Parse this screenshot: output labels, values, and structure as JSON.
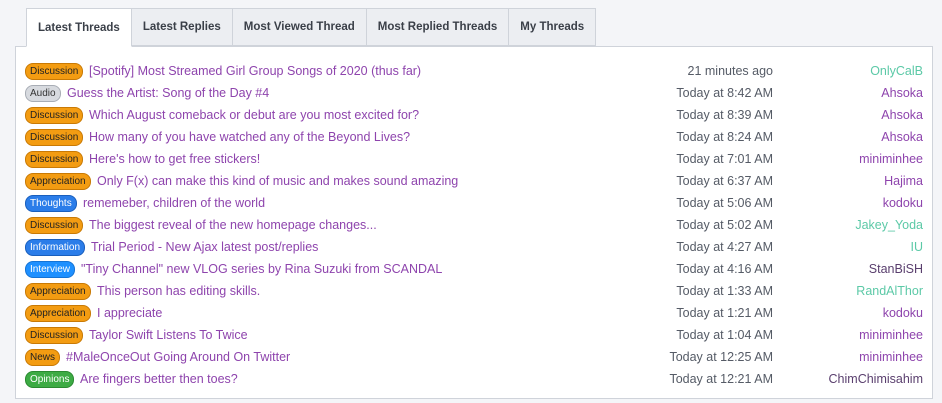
{
  "tabs": [
    {
      "label": "Latest Threads",
      "active": true
    },
    {
      "label": "Latest Replies",
      "active": false
    },
    {
      "label": "Most Viewed Thread",
      "active": false
    },
    {
      "label": "Most Replied Threads",
      "active": false
    },
    {
      "label": "My Threads",
      "active": false
    }
  ],
  "prefix_styles": {
    "Discussion": {
      "bg": "#f39c12",
      "border": "#c97a05",
      "color": "#222222"
    },
    "Audio": {
      "bg": "#d7dadf",
      "border": "#a8adb5",
      "color": "#333333"
    },
    "Appreciation": {
      "bg": "#f39c12",
      "border": "#c97a05",
      "color": "#222222"
    },
    "Thoughts": {
      "bg": "#2b7de9",
      "border": "#1a5fbd",
      "color": "#ffffff"
    },
    "Information": {
      "bg": "#2b7de9",
      "border": "#1a5fbd",
      "color": "#ffffff"
    },
    "Interview": {
      "bg": "#1e90ff",
      "border": "#1573d4",
      "color": "#ffffff"
    },
    "News": {
      "bg": "#f39c12",
      "border": "#c97a05",
      "color": "#222222"
    },
    "Opinions": {
      "bg": "#3dab44",
      "border": "#2b8a31",
      "color": "#ffffff"
    }
  },
  "user_colors": {
    "default": "#8e44ad",
    "teal": "#5cc9a7",
    "dark": "#5a3f6e"
  },
  "threads": [
    {
      "prefix": "Discussion",
      "title": "[Spotify] Most Streamed Girl Group Songs of 2020 (thus far)",
      "time": "21 minutes ago",
      "user": "OnlyCalB",
      "user_color": "teal"
    },
    {
      "prefix": "Audio",
      "title": "Guess the Artist: Song of the Day #4",
      "time": "Today at 8:42 AM",
      "user": "Ahsoka",
      "user_color": "default"
    },
    {
      "prefix": "Discussion",
      "title": "Which August comeback or debut are you most excited for?",
      "time": "Today at 8:39 AM",
      "user": "Ahsoka",
      "user_color": "default"
    },
    {
      "prefix": "Discussion",
      "title": "How many of you have watched any of the Beyond Lives?",
      "time": "Today at 8:24 AM",
      "user": "Ahsoka",
      "user_color": "default"
    },
    {
      "prefix": "Discussion",
      "title": "Here's how to get free stickers!",
      "time": "Today at 7:01 AM",
      "user": "miniminhee",
      "user_color": "default"
    },
    {
      "prefix": "Appreciation",
      "title": "Only F(x) can make this kind of music and makes sound amazing",
      "time": "Today at 6:37 AM",
      "user": "Hajima",
      "user_color": "default"
    },
    {
      "prefix": "Thoughts",
      "title": "rememeber, children of the world",
      "time": "Today at 5:06 AM",
      "user": "kodoku",
      "user_color": "default"
    },
    {
      "prefix": "Discussion",
      "title": "The biggest reveal of the new homepage changes...",
      "time": "Today at 5:02 AM",
      "user": "Jakey_Yoda",
      "user_color": "teal"
    },
    {
      "prefix": "Information",
      "title": "Trial Period - New Ajax latest post/replies",
      "time": "Today at 4:27 AM",
      "user": "IU",
      "user_color": "teal"
    },
    {
      "prefix": "Interview",
      "title": "\"Tiny Channel\" new VLOG series by Rina Suzuki from SCANDAL",
      "time": "Today at 4:16 AM",
      "user": "StanBiSH",
      "user_color": "dark"
    },
    {
      "prefix": "Appreciation",
      "title": "This person has editing skills.",
      "time": "Today at 1:33 AM",
      "user": "RandAlThor",
      "user_color": "teal"
    },
    {
      "prefix": "Appreciation",
      "title": "I appreciate",
      "time": "Today at 1:21 AM",
      "user": "kodoku",
      "user_color": "default"
    },
    {
      "prefix": "Discussion",
      "title": "Taylor Swift Listens To Twice",
      "time": "Today at 1:04 AM",
      "user": "miniminhee",
      "user_color": "default"
    },
    {
      "prefix": "News",
      "title": "#MaleOnceOut Going Around On Twitter",
      "time": "Today at 12:25 AM",
      "user": "miniminhee",
      "user_color": "default"
    },
    {
      "prefix": "Opinions",
      "title": "Are fingers better then toes?",
      "time": "Today at 12:21 AM",
      "user": "ChimChimisahim",
      "user_color": "dark"
    }
  ]
}
